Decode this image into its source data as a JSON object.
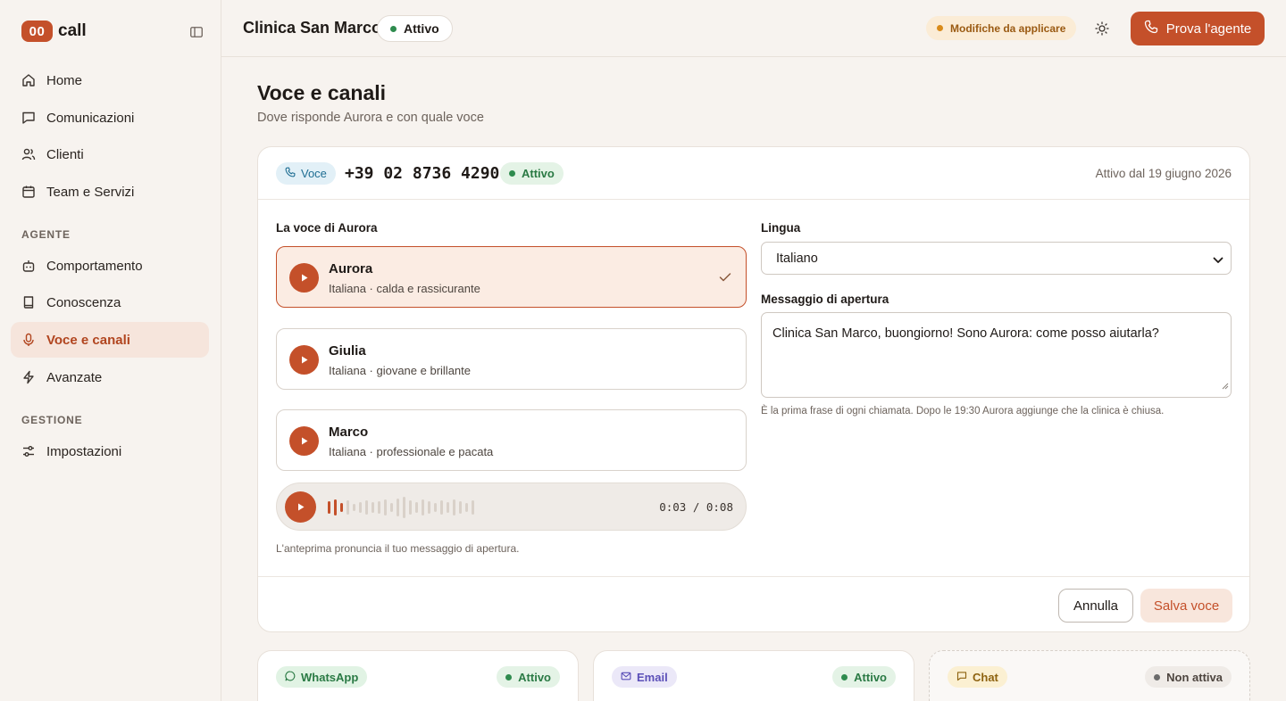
{
  "brand": {
    "badge": "00",
    "name": "call"
  },
  "sidebar": {
    "items": [
      {
        "label": "Home",
        "icon": "home-icon"
      },
      {
        "label": "Comunicazioni",
        "icon": "message-icon"
      },
      {
        "label": "Clienti",
        "icon": "users-icon"
      },
      {
        "label": "Team e Servizi",
        "icon": "calendar-icon"
      }
    ],
    "section_agent": "AGENTE",
    "agent_items": [
      {
        "label": "Comportamento",
        "icon": "bot-icon"
      },
      {
        "label": "Conoscenza",
        "icon": "book-icon"
      },
      {
        "label": "Voce e canali",
        "icon": "mic-icon",
        "active": true
      },
      {
        "label": "Avanzate",
        "icon": "zap-icon"
      }
    ],
    "section_manage": "GESTIONE",
    "manage_items": [
      {
        "label": "Impostazioni",
        "icon": "sliders-icon"
      }
    ]
  },
  "header": {
    "clinic_name": "Clinica San Marco",
    "status": "Attivo",
    "pending": "Modifiche da applicare",
    "try_button": "Prova l'agente"
  },
  "page": {
    "title": "Voce e canali",
    "subtitle": "Dove risponde Aurora e con quale voce"
  },
  "voice_card": {
    "tag": "Voce",
    "phone": "+39 02 8736 4290",
    "status": "Attivo",
    "since": "Attivo dal 19 giugno 2026",
    "voice_label": "La voce di Aurora",
    "voices": [
      {
        "name": "Aurora",
        "desc": "Italiana · calda e rassicurante",
        "selected": true
      },
      {
        "name": "Giulia",
        "desc": "Italiana · giovane e brillante",
        "selected": false
      },
      {
        "name": "Marco",
        "desc": "Italiana · professionale e pacata",
        "selected": false
      }
    ],
    "player": {
      "time": "0:03 / 0:08",
      "progress": 0.375
    },
    "preview_note": "L'anteprima pronuncia il tuo messaggio di apertura.",
    "language_label": "Lingua",
    "language_value": "Italiano",
    "opening_label": "Messaggio di apertura",
    "opening_text": "Clinica San Marco, buongiorno! Sono Aurora: come posso aiutarla?",
    "helper": "È la prima frase di ogni chiamata. Dopo le 19:30 Aurora aggiunge che la clinica è chiusa.",
    "cancel": "Annulla",
    "save": "Salva voce"
  },
  "channels": [
    {
      "name": "WhatsApp",
      "status": "Attivo"
    },
    {
      "name": "Email",
      "status": "Attivo"
    },
    {
      "name": "Chat",
      "status": "Non attiva"
    }
  ],
  "colors": {
    "accent": "#c4502a",
    "active_green": "#2e8b4e",
    "background": "#f7f3ef"
  }
}
